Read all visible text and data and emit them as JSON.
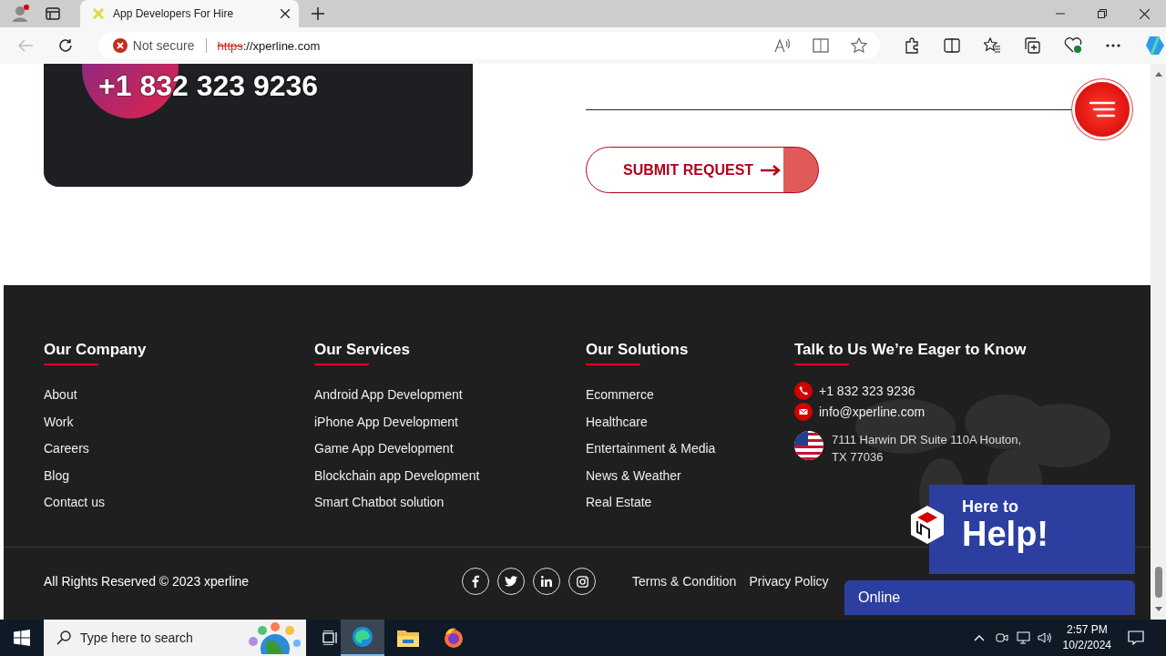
{
  "browser": {
    "tab_title": "App Developers For Hire",
    "security": "Not secure",
    "url_scheme": "https",
    "url_rest": "://xperline.com"
  },
  "contact_card": {
    "phone": "+1 832 323 9236"
  },
  "form": {
    "submit": "SUBMIT REQUEST"
  },
  "footer": {
    "columns": [
      {
        "heading": "Our Company",
        "links": [
          "About",
          "Work",
          "Careers",
          "Blog",
          "Contact us"
        ]
      },
      {
        "heading": "Our Services",
        "links": [
          "Android App Development",
          "iPhone App Development",
          "Game App Development",
          "Blockchain app Development",
          "Smart Chatbot solution"
        ]
      },
      {
        "heading": "Our Solutions",
        "links": [
          "Ecommerce",
          "Healthcare",
          "Entertainment & Media",
          "News & Weather",
          "Real Estate"
        ]
      }
    ],
    "contact": {
      "heading": "Talk to Us We’re Eager to Know",
      "phone": "+1 832 323 9236",
      "email": "info@xperline.com",
      "address": "7111 Harwin DR Suite 110A Houton, TX 77036"
    },
    "copyright": "All Rights Reserved © 2023 xperline",
    "bottom_links": [
      "Terms & Condition",
      "Privacy Policy"
    ]
  },
  "chat_widget": {
    "line1": "Here to",
    "line2": "Help!",
    "status": "Online"
  },
  "taskbar": {
    "search_placeholder": "Type here to search",
    "time": "2:57 PM",
    "date": "10/2/2024"
  }
}
